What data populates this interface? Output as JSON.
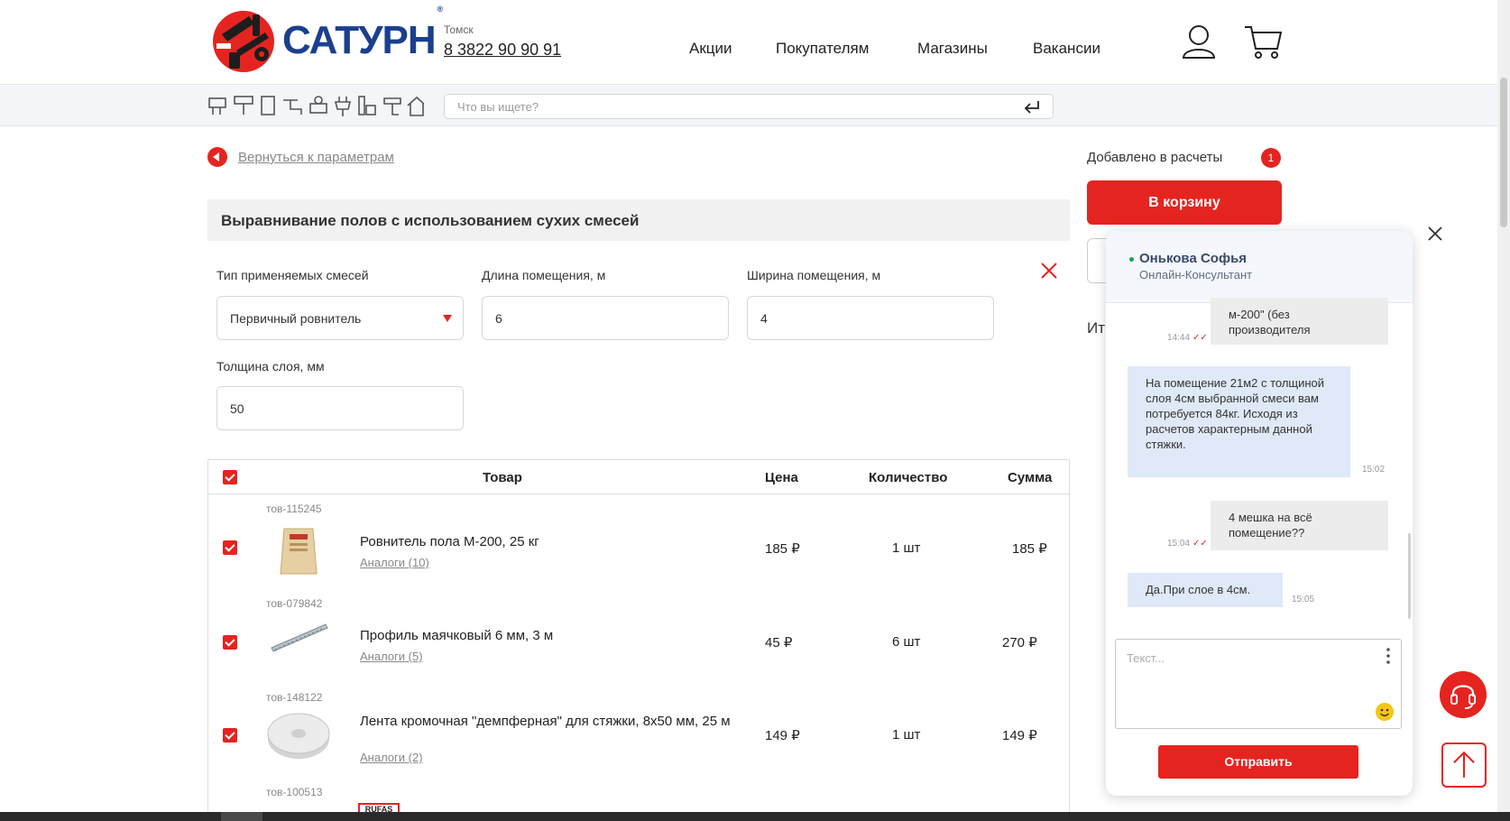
{
  "header": {
    "brand": "САТУРН",
    "reg_mark": "®",
    "city": "Томск",
    "phone": "8 3822 90 90 91",
    "nav": [
      "Акции",
      "Покупателям",
      "Магазины",
      "Вакансии"
    ]
  },
  "search": {
    "placeholder": "Что вы ищете?"
  },
  "back_link": "Вернуться к параметрам",
  "calc": {
    "title": "Выравнивание полов с использованием сухих смесей",
    "fields": {
      "mix_type": {
        "label": "Тип применяемых смесей",
        "value": "Первичный ровнитель"
      },
      "length": {
        "label": "Длина помещения, м",
        "value": "6"
      },
      "width": {
        "label": "Ширина помещения, м",
        "value": "4"
      },
      "thickness": {
        "label": "Толщина слоя, мм",
        "value": "50"
      }
    }
  },
  "table": {
    "headers": {
      "product": "Товар",
      "price": "Цена",
      "qty": "Количество",
      "sum": "Сумма"
    },
    "rows": [
      {
        "sku": "тов-115245",
        "name": "Ровнитель пола М-200, 25 кг",
        "analogs": "Аналоги (10)",
        "price": "185 ₽",
        "qty": "1 шт",
        "sum": "185 ₽",
        "checked": true
      },
      {
        "sku": "тов-079842",
        "name": "Профиль маячковый 6 мм, 3 м",
        "analogs": "Аналоги (5)",
        "price": "45 ₽",
        "qty": "6 шт",
        "sum": "270 ₽",
        "checked": true
      },
      {
        "sku": "тов-148122",
        "name": "Лента кромочная \"демпферная\" для стяжки, 8х50 мм, 25 м",
        "analogs": "Аналоги (2)",
        "price": "149 ₽",
        "qty": "1 шт",
        "sum": "149 ₽",
        "checked": true
      },
      {
        "sku": "тов-100513",
        "thumb_text": "RUFAS"
      }
    ]
  },
  "side": {
    "added_label": "Добавлено в расчеты",
    "added_count": "1",
    "cart_button": "В корзину",
    "total_label": "Ит"
  },
  "chat": {
    "agent_name": "Онькова Софья",
    "agent_role": "Онлайн-Консультант",
    "messages": [
      {
        "side": "out",
        "text": "м-200\" (без производителя",
        "time": "14:44"
      },
      {
        "side": "in",
        "text": "На помещение 21м2 с толщиной слоя 4см выбранной смеси вам потребуется 84кг.  Исходя из расчетов характерным данной стяжки.",
        "time": "15:02"
      },
      {
        "side": "out",
        "text": "4 мешка на всё помещение??",
        "time": "15:04"
      },
      {
        "side": "in",
        "text": "Да.При слое в 4см.",
        "time": "15:05"
      }
    ],
    "input_placeholder": "Текст...",
    "send_button": "Отправить"
  },
  "colors": {
    "accent": "#e52420",
    "brand_blue": "#1b3f8f",
    "chat_in": "#dfe9f8",
    "chat_out": "#ececec"
  }
}
